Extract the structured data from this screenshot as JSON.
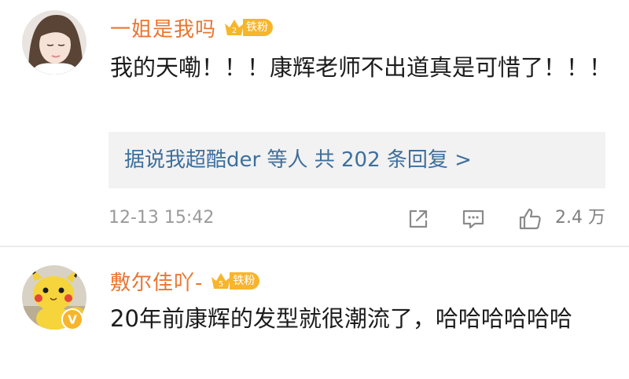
{
  "comments": [
    {
      "username": "一姐是我吗",
      "fan_badge": {
        "level": "2",
        "label": "铁粉"
      },
      "text": "我的天嘞！！！康辉老师不出道真是可惜了！！！",
      "replies_link": "据说我超酷der 等人  共 202 条回复 >",
      "timestamp": "12-13 15:42",
      "likes": "2.4 万",
      "icons": {
        "share": "share-icon",
        "comment": "comment-icon",
        "like": "thumbs-up-icon"
      }
    },
    {
      "username": "敷尔佳吖-",
      "fan_badge": {
        "level": "5",
        "label": "铁粉"
      },
      "text": "20年前康辉的发型就很潮流了，哈哈哈哈哈哈",
      "verified_badge": "V"
    }
  ],
  "colors": {
    "username": "#e9752f",
    "link": "#3e6f9d",
    "fan_badge": "#f7b52c",
    "meta_text": "#9a9a9a",
    "reply_background": "#f2f2f2"
  }
}
